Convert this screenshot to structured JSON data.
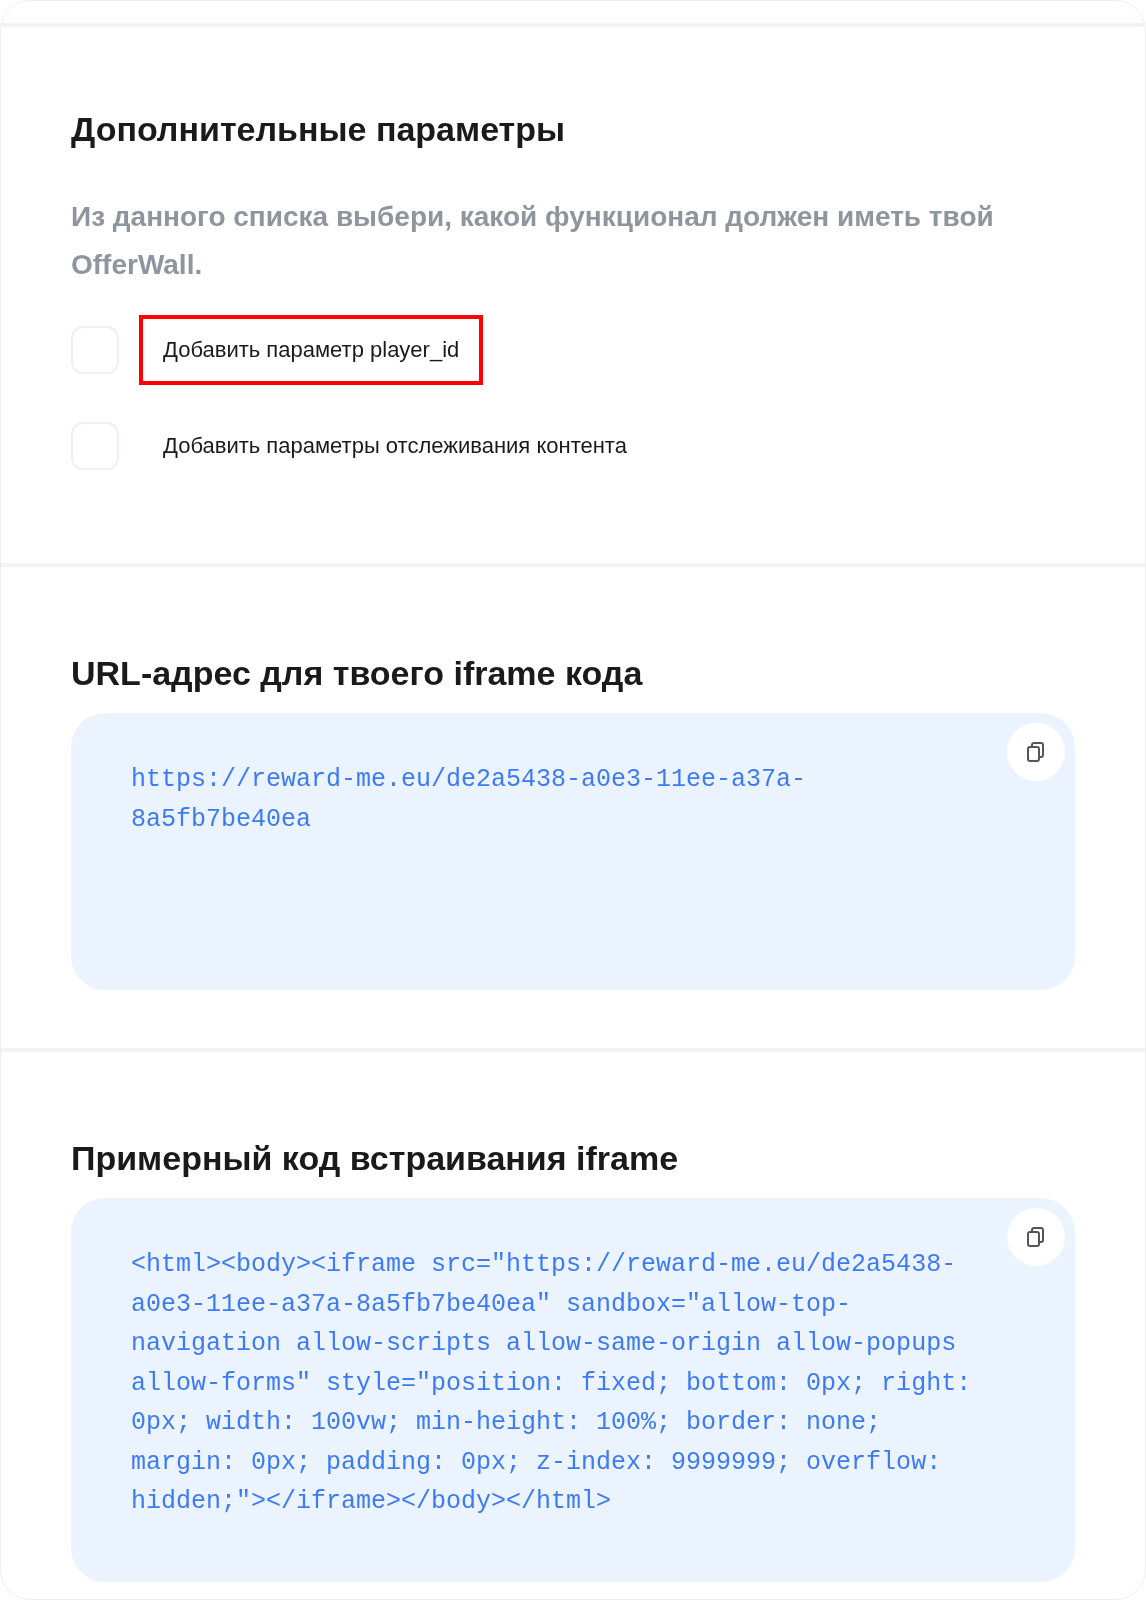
{
  "sections": [
    {
      "kind": "options",
      "title": "Дополнительные параметры",
      "description": "Из данного списка выбери, какой функционал должен иметь твой OfferWall.",
      "options": [
        {
          "label": "Добавить параметр player_id",
          "checked": false,
          "highlighted": true
        },
        {
          "label": "Добавить параметры отслеживания контента",
          "checked": false,
          "highlighted": false
        }
      ]
    },
    {
      "kind": "code",
      "title": "URL-адрес для твоего iframe кода",
      "code": "https://reward-me.eu/de2a5438-a0e3-11ee-a37a-8a5fb7be40ea"
    },
    {
      "kind": "code",
      "title": "Примерный код встраивания iframe",
      "code": "<html><body><iframe src=\"https://reward-me.eu/de2a5438-a0e3-11ee-a37a-8a5fb7be40ea\" sandbox=\"allow-top-navigation allow-scripts allow-same-origin allow-popups allow-forms\" style=\"position: fixed; bottom: 0px; right: 0px; width: 100vw; min-height: 100%; border: none; margin: 0px; padding: 0px; z-index: 9999999; overflow: hidden;\"></iframe></body></html>"
    }
  ]
}
